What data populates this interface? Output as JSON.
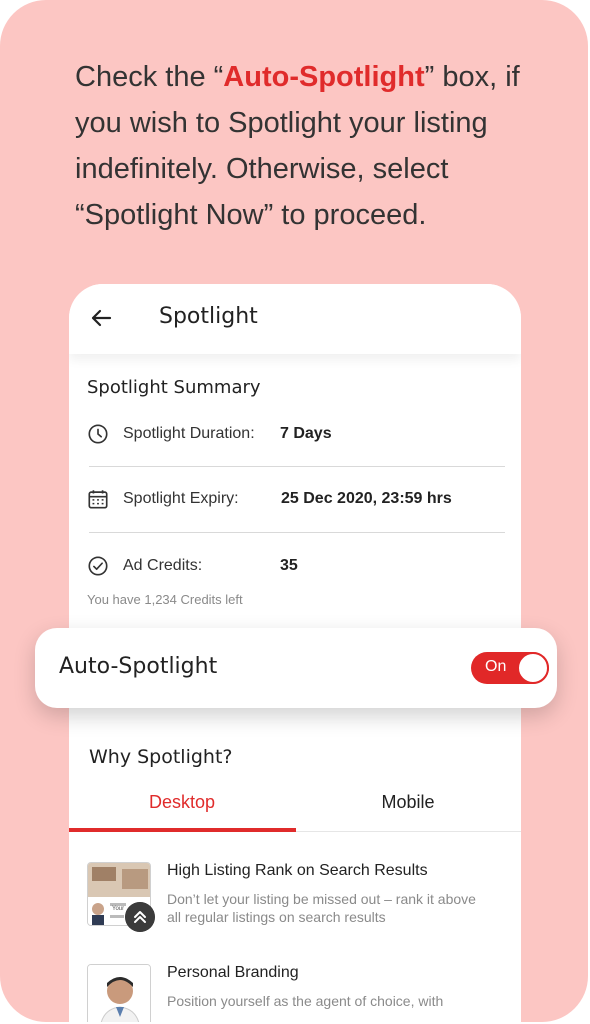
{
  "instruction": {
    "prefix": "Check the “",
    "highlight": "Auto-Spotlight",
    "suffix": "” box, if you wish to Spotlight your listing indefinitely. Otherwise, select “Spotlight Now” to proceed."
  },
  "appbar": {
    "title": "Spotlight",
    "back_icon": "arrow-left-icon"
  },
  "summary": {
    "title": "Spotlight Summary",
    "duration_label": "Spotlight Duration:",
    "duration_value": "7 Days",
    "expiry_label": "Spotlight Expiry:",
    "expiry_value": "25 Dec 2020, 23:59 hrs",
    "credits_label": "Ad Credits:",
    "credits_value": "35",
    "credits_note": "You have 1,234 Credits left"
  },
  "auto_spotlight": {
    "label": "Auto-Spotlight",
    "state": "On",
    "enabled": true
  },
  "why": {
    "title": "Why Spotlight?",
    "tabs": [
      {
        "label": "Desktop",
        "active": true
      },
      {
        "label": "Mobile",
        "active": false
      }
    ],
    "features": [
      {
        "title": "High Listing Rank on Search Results",
        "desc": "Don’t let your listing be missed out – rank it above all regular listings on search results",
        "thumb_text": "Your"
      },
      {
        "title": "Personal Branding",
        "desc": "Position yourself as the agent of choice, with"
      }
    ]
  },
  "colors": {
    "background": "#fcc6c3",
    "accent": "#e02b2b"
  }
}
